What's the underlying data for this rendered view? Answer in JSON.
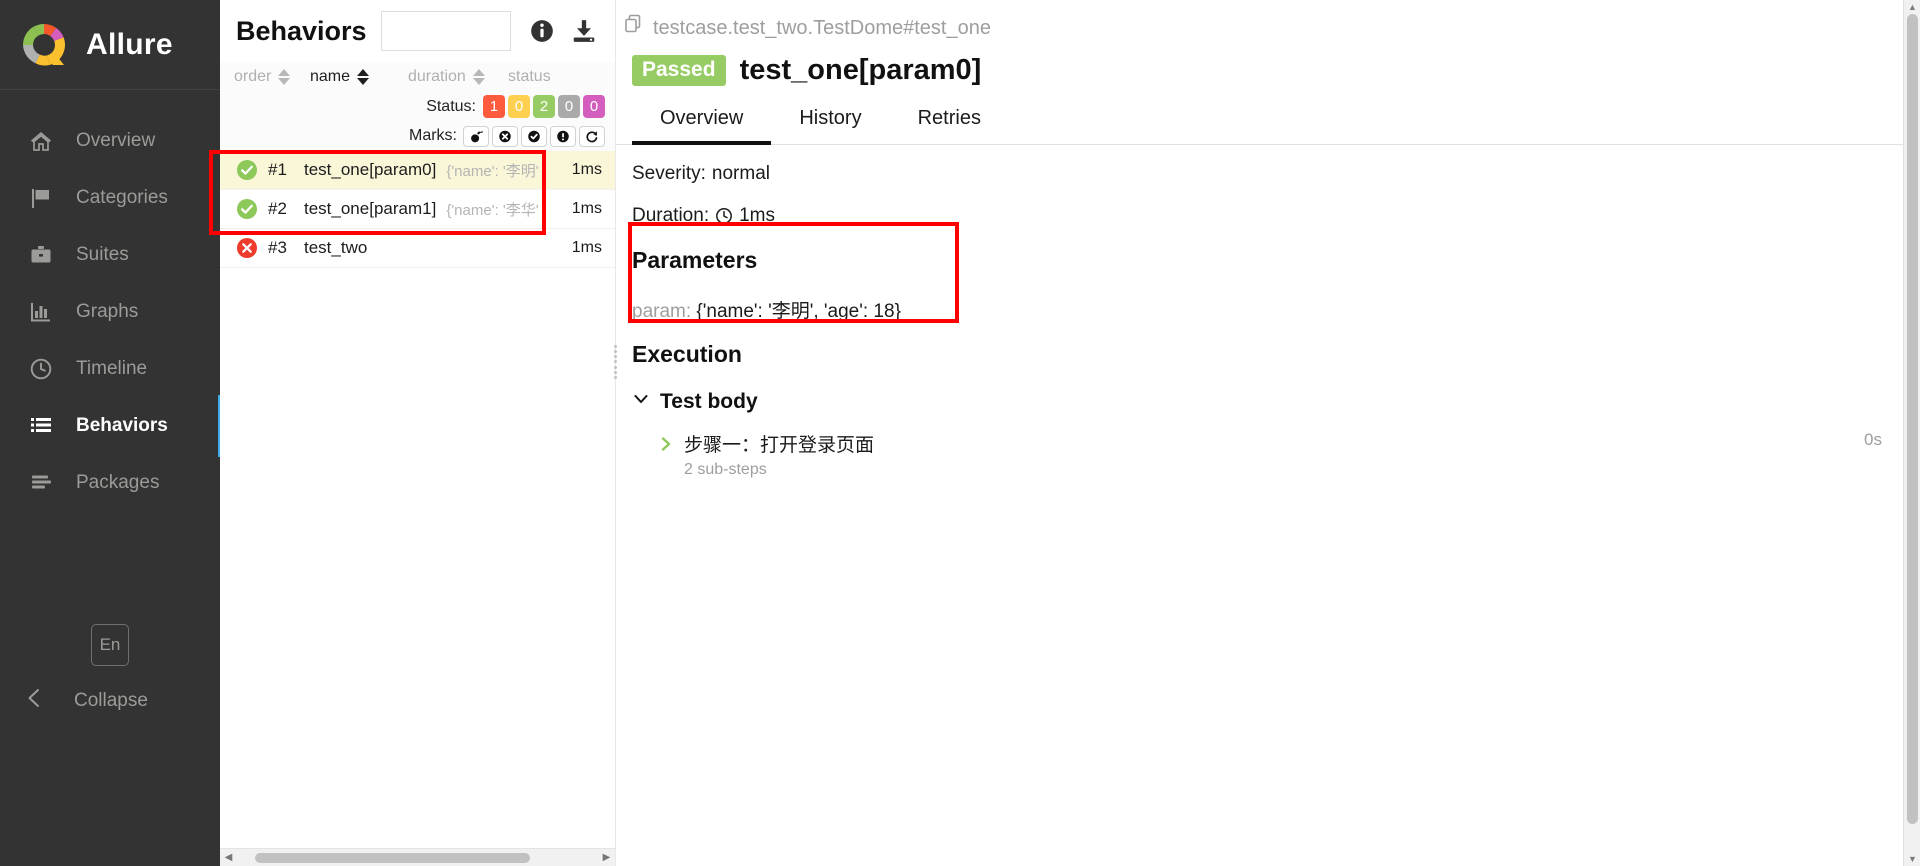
{
  "sidebar": {
    "brand": "Allure",
    "items": [
      {
        "label": "Overview",
        "icon": "home-icon"
      },
      {
        "label": "Categories",
        "icon": "flag-icon"
      },
      {
        "label": "Suites",
        "icon": "briefcase-icon"
      },
      {
        "label": "Graphs",
        "icon": "bar-chart-icon"
      },
      {
        "label": "Timeline",
        "icon": "clock-icon"
      },
      {
        "label": "Behaviors",
        "icon": "list-icon"
      },
      {
        "label": "Packages",
        "icon": "stack-icon"
      }
    ],
    "active_item": "Behaviors",
    "language": "En",
    "collapse": "Collapse",
    "accent_color": "#3faee8"
  },
  "list_panel": {
    "title": "Behaviors",
    "search_value": "",
    "search_placeholder": "",
    "info_icon": "info-icon",
    "download_icon": "download-icon",
    "columns": [
      {
        "label": "order",
        "sorted": false
      },
      {
        "label": "name",
        "sorted": true
      },
      {
        "label": "duration",
        "sorted": false
      },
      {
        "label": "status",
        "sorted": false
      }
    ],
    "status_label": "Status:",
    "status_badges": [
      {
        "value": "1",
        "color": "#fd5a3e"
      },
      {
        "value": "0",
        "color": "#ffd050"
      },
      {
        "value": "2",
        "color": "#97cc64"
      },
      {
        "value": "0",
        "color": "#aaaaaa"
      },
      {
        "value": "0",
        "color": "#d35ebe"
      }
    ],
    "marks_label": "Marks:",
    "marks": [
      "bomb-icon",
      "x-circle-icon",
      "check-circle-icon",
      "exclamation-circle-icon",
      "refresh-icon"
    ],
    "rows": [
      {
        "status": "passed",
        "order": "#1",
        "name": "test_one[param0]",
        "params": "{'name': '李明'",
        "duration": "1ms",
        "selected": true
      },
      {
        "status": "passed",
        "order": "#2",
        "name": "test_one[param1]",
        "params": "{'name': '李华'",
        "duration": "1ms",
        "selected": false
      },
      {
        "status": "failed",
        "order": "#3",
        "name": "test_two",
        "params": "",
        "duration": "1ms",
        "selected": false
      }
    ]
  },
  "detail": {
    "breadcrumb": "testcase.test_two.TestDome#test_one",
    "breadcrumb_icon": "copy-icon",
    "status_badge": "Passed",
    "status_badge_color": "#97cc64",
    "title": "test_one[param0]",
    "tabs": [
      {
        "label": "Overview",
        "active": true
      },
      {
        "label": "History",
        "active": false
      },
      {
        "label": "Retries",
        "active": false
      }
    ],
    "severity_label": "Severity:",
    "severity_value": "normal",
    "duration_label": "Duration:",
    "duration_icon": "clock-icon",
    "duration_value": "1ms",
    "parameters_title": "Parameters",
    "parameter_key": "param:",
    "parameter_value": "{'name': '李明', 'age': 18}",
    "execution_title": "Execution",
    "test_body_label": "Test body",
    "step_label": "步骤一：打开登录页面",
    "step_substeps": "2 sub-steps",
    "step_time": "0s"
  }
}
